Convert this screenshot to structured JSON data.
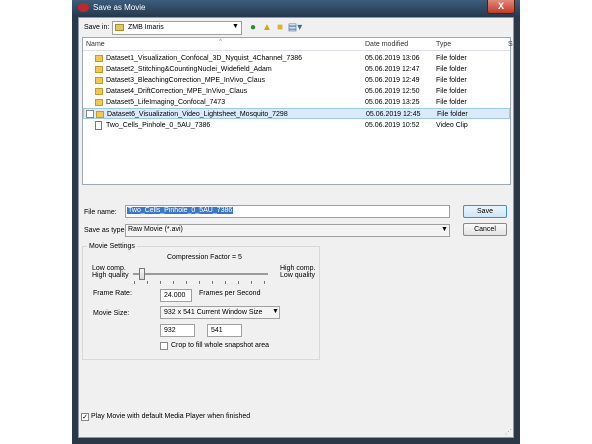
{
  "window": {
    "title": "Save as Movie",
    "close_glyph": "X"
  },
  "save_in": {
    "label": "Save in:",
    "value": "ZMB Imaris"
  },
  "list": {
    "columns": {
      "name": "Name",
      "date": "Date modified",
      "type": "Type",
      "size": "S"
    },
    "rows": [
      {
        "name": "Dataset1_Visualization_Confocal_3D_Nyquist_4Channel_7386",
        "date": "05.06.2019 13:06",
        "type": "File folder",
        "kind": "folder"
      },
      {
        "name": "Dataset2_Stitching&CountingNuclei_Widefield_Adam",
        "date": "05.06.2019 12:47",
        "type": "File folder",
        "kind": "folder"
      },
      {
        "name": "Dataset3_BleachingCorrection_MPE_InVivo_Claus",
        "date": "05.06.2019 12:49",
        "type": "File folder",
        "kind": "folder"
      },
      {
        "name": "Dataset4_DriftCorrection_MPE_InVivo_Claus",
        "date": "05.06.2019 12:50",
        "type": "File folder",
        "kind": "folder"
      },
      {
        "name": "Dataset5_LifeImaging_Confocal_7473",
        "date": "05.06.2019 13:25",
        "type": "File folder",
        "kind": "folder"
      },
      {
        "name": "Dataset6_Visualization_Video_Lightsheet_Mosquito_7298",
        "date": "05.06.2019 12:45",
        "type": "File folder",
        "kind": "folder",
        "selected": true
      },
      {
        "name": "Two_Cells_Pinhole_0_5AU_7386",
        "date": "05.06.2019 10:52",
        "type": "Video Clip",
        "kind": "video"
      }
    ]
  },
  "file_name": {
    "label": "File name:",
    "value": "Two_Cells_Pinhole_0_5AU_7386"
  },
  "save_type": {
    "label": "Save as type:",
    "value": "Raw Movie (*.avi)"
  },
  "buttons": {
    "save": "Save",
    "cancel": "Cancel"
  },
  "movie_settings": {
    "title": "Movie Settings",
    "compression_label": "Compression Factor = 5",
    "compression_value": 5,
    "low_comp": "Low comp.",
    "high_quality": "High quality",
    "high_comp": "High comp.",
    "low_quality": "Low quality",
    "frame_rate_label": "Frame Rate:",
    "frame_rate_value": "24.000",
    "fps_label": "Frames per Second",
    "movie_size_label": "Movie Size:",
    "movie_size_value": "932 x 541 Current Window Size",
    "width": "932",
    "height": "541",
    "crop_label": "Crop to fill whole snapshot area",
    "crop_checked": false
  },
  "play_movie": {
    "label": "Play Movie with default Media Player when finished",
    "checked": true
  },
  "icons": {
    "back": "back-arrow-icon",
    "up": "up-folder-icon",
    "new_folder": "new-folder-icon",
    "views": "views-menu-icon"
  }
}
